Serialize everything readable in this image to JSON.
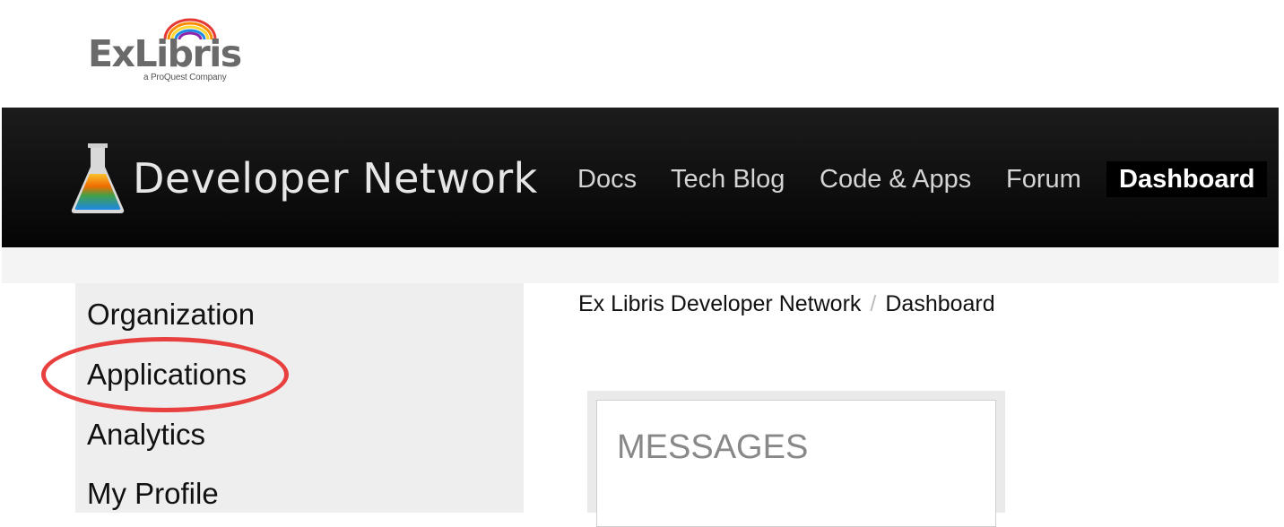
{
  "logo": {
    "wordmark": "ExLibris",
    "tagline": "a ProQuest Company"
  },
  "header": {
    "brand": "Developer Network",
    "nav": [
      {
        "label": "Docs"
      },
      {
        "label": "Tech Blog"
      },
      {
        "label": "Code & Apps"
      },
      {
        "label": "Forum"
      },
      {
        "label": "Dashboard",
        "active": true
      }
    ]
  },
  "sidebar": {
    "items": [
      {
        "label": "Organization"
      },
      {
        "label": "Applications",
        "highlighted": true
      },
      {
        "label": "Analytics"
      },
      {
        "label": "My Profile"
      }
    ]
  },
  "breadcrumb": {
    "root": "Ex Libris Developer Network",
    "separator": "/",
    "current": "Dashboard"
  },
  "messages": {
    "title": "MESSAGES"
  },
  "colors": {
    "header_bg": "#0a0a0a",
    "sidebar_bg": "#eeeeee",
    "highlight": "#e8403f"
  }
}
